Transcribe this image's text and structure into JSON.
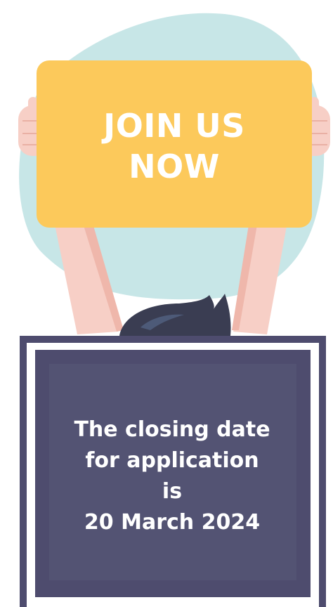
{
  "sign": {
    "line1": "JOIN US",
    "line2": "NOW"
  },
  "board": {
    "line1": "The closing date",
    "line2": "for application",
    "line3": "is",
    "line4": "20 March 2024"
  },
  "colors": {
    "blob": "#c7e6e7",
    "sign": "#fcc95b",
    "skin": "#f7cfc6",
    "hair": "#3a3d52",
    "board_outer": "#4e4c6e",
    "board_inner": "#535373"
  }
}
